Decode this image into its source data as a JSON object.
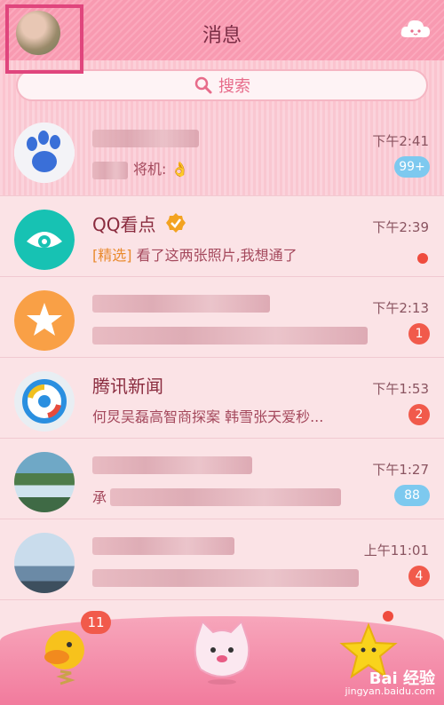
{
  "header": {
    "title": "消息"
  },
  "search": {
    "placeholder": "搜索"
  },
  "conversations": [
    {
      "name": "",
      "message": "将机:",
      "time": "下午2:41",
      "badge": "99+",
      "badge_color": "#7dc9ef",
      "avatar_icon": "paw-icon",
      "pinned": true
    },
    {
      "name": "QQ看点",
      "tag": "[精选]",
      "message": "看了这两张照片,我想通了",
      "time": "下午2:39",
      "badge": "",
      "avatar_icon": "eye-icon"
    },
    {
      "name": "",
      "message": "",
      "time": "下午2:13",
      "badge": "1",
      "badge_color": "#f15a4b",
      "avatar_icon": "star-icon"
    },
    {
      "name": "腾讯新闻",
      "message": "何炅吴磊高智商探案 韩雪张天爱秒...",
      "time": "下午1:53",
      "badge": "2",
      "badge_color": "#f15a4b",
      "avatar_icon": "news-logo-icon"
    },
    {
      "name": "",
      "message": "承",
      "time": "下午1:27",
      "badge": "88",
      "badge_color": "#7dc9ef",
      "avatar_icon": "landscape-avatar"
    },
    {
      "name": "",
      "message": "",
      "time": "上午11:01",
      "badge": "4",
      "badge_color": "#f15a4b",
      "avatar_icon": "city-avatar"
    }
  ],
  "bottom_nav": {
    "messages_badge": "11",
    "watermark_brand": "Bai 经验",
    "watermark_url": "jingyan.baidu.com"
  },
  "colors": {
    "accent": "#e0457d",
    "badge_red": "#f15a4b",
    "badge_blue": "#7dc9ef"
  }
}
